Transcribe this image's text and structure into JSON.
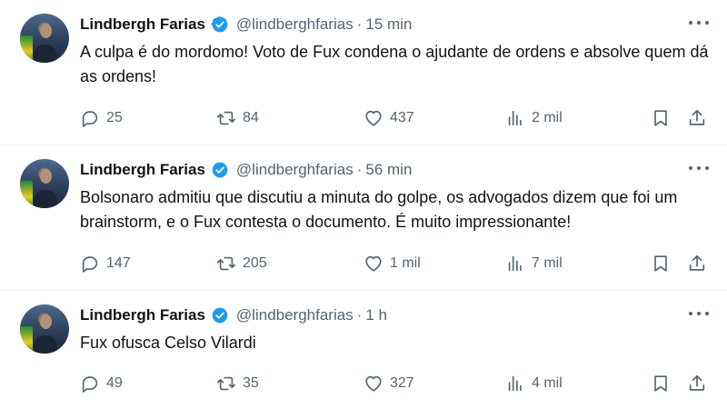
{
  "tweets": [
    {
      "author": "Lindbergh Farias",
      "handle": "@lindberghfarias",
      "separator": "·",
      "time": "15 min",
      "text": "A culpa é do mordomo! Voto de Fux condena o ajudante de ordens e absolve quem dá as ordens!",
      "replies": "25",
      "retweets": "84",
      "likes": "437",
      "views": "2 mil"
    },
    {
      "author": "Lindbergh Farias",
      "handle": "@lindberghfarias",
      "separator": "·",
      "time": "56 min",
      "text": "Bolsonaro admitiu que discutiu a minuta do golpe, os advogados dizem que foi um brainstorm, e o Fux contesta o documento. É muito impressionante!",
      "replies": "147",
      "retweets": "205",
      "likes": "1 mil",
      "views": "7 mil"
    },
    {
      "author": "Lindbergh Farias",
      "handle": "@lindberghfarias",
      "separator": "·",
      "time": "1 h",
      "text": "Fux ofusca Celso Vilardi",
      "replies": "49",
      "retweets": "35",
      "likes": "327",
      "views": "4 mil"
    }
  ],
  "icons": {
    "verified": "verified-badge-icon",
    "more": "more-options-icon",
    "reply": "reply-icon",
    "retweet": "retweet-icon",
    "like": "like-icon",
    "views": "views-icon",
    "bookmark": "bookmark-icon",
    "share": "share-icon"
  },
  "colors": {
    "verified": "#1d9bf0",
    "secondary_text": "#536471",
    "primary_text": "#0f1419",
    "divider": "#eff3f4"
  }
}
